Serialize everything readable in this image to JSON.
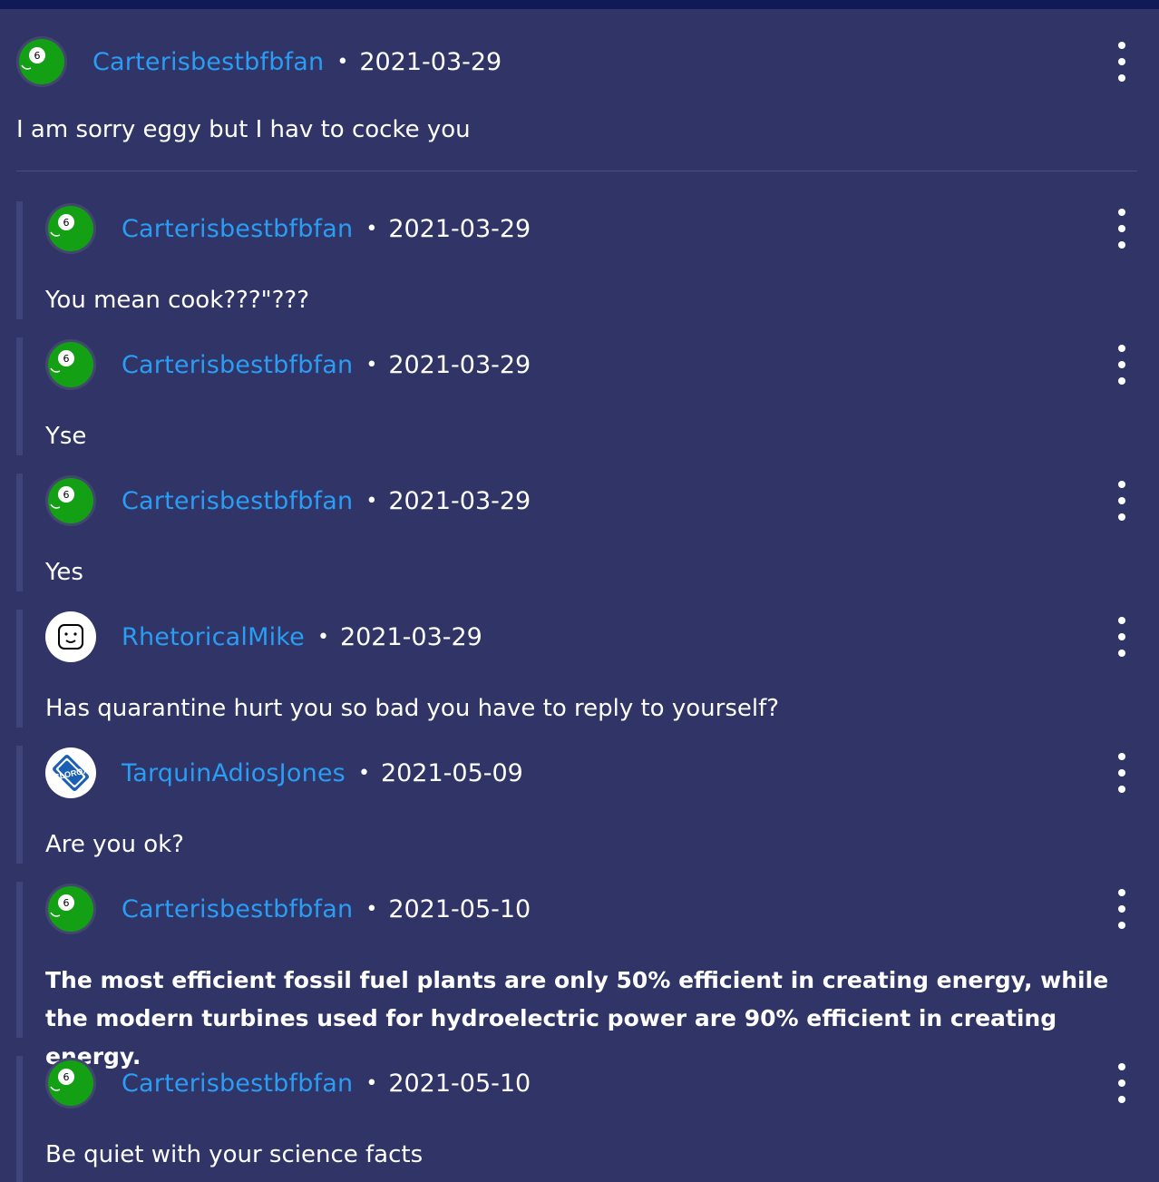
{
  "comments": [
    {
      "username": "Carterisbestbfbfan",
      "date": "2021-03-29",
      "text": "I am sorry eggy but I hav to cocke you",
      "avatar": "ball-6-avatar"
    },
    {
      "username": "Carterisbestbfbfan",
      "date": "2021-03-29",
      "text": "You mean cook???\"???",
      "avatar": "ball-6-avatar"
    },
    {
      "username": "Carterisbestbfbfan",
      "date": "2021-03-29",
      "text": "Yse",
      "avatar": "ball-6-avatar"
    },
    {
      "username": "Carterisbestbfbfan",
      "date": "2021-03-29",
      "text": "Yes",
      "avatar": "ball-6-avatar"
    },
    {
      "username": "RhetoricalMike",
      "date": "2021-03-29",
      "text": "Has quarantine hurt you so bad you have to reply to yourself?",
      "avatar": "smiley-box-avatar"
    },
    {
      "username": "TarquinAdiosJones",
      "date": "2021-05-09",
      "text": "Are you ok?",
      "avatar": "clorox-avatar",
      "avatar_text": "CLOROX"
    },
    {
      "username": "Carterisbestbfbfan",
      "date": "2021-05-10",
      "text": "The most efficient fossil fuel plants are only 50% efficient in creating energy, while the modern turbines used for hydroelectric power are 90% efficient in creating energy.",
      "avatar": "ball-6-avatar"
    },
    {
      "username": "Carterisbestbfbfan",
      "date": "2021-05-10",
      "text": "Be quiet with your science facts",
      "avatar": "ball-6-avatar"
    }
  ],
  "separator": "•",
  "ball_number": "6",
  "colors": {
    "background": "#303466",
    "username": "#2a9df4",
    "reply_bar": "#3f447a",
    "ball_green": "#14a014"
  }
}
